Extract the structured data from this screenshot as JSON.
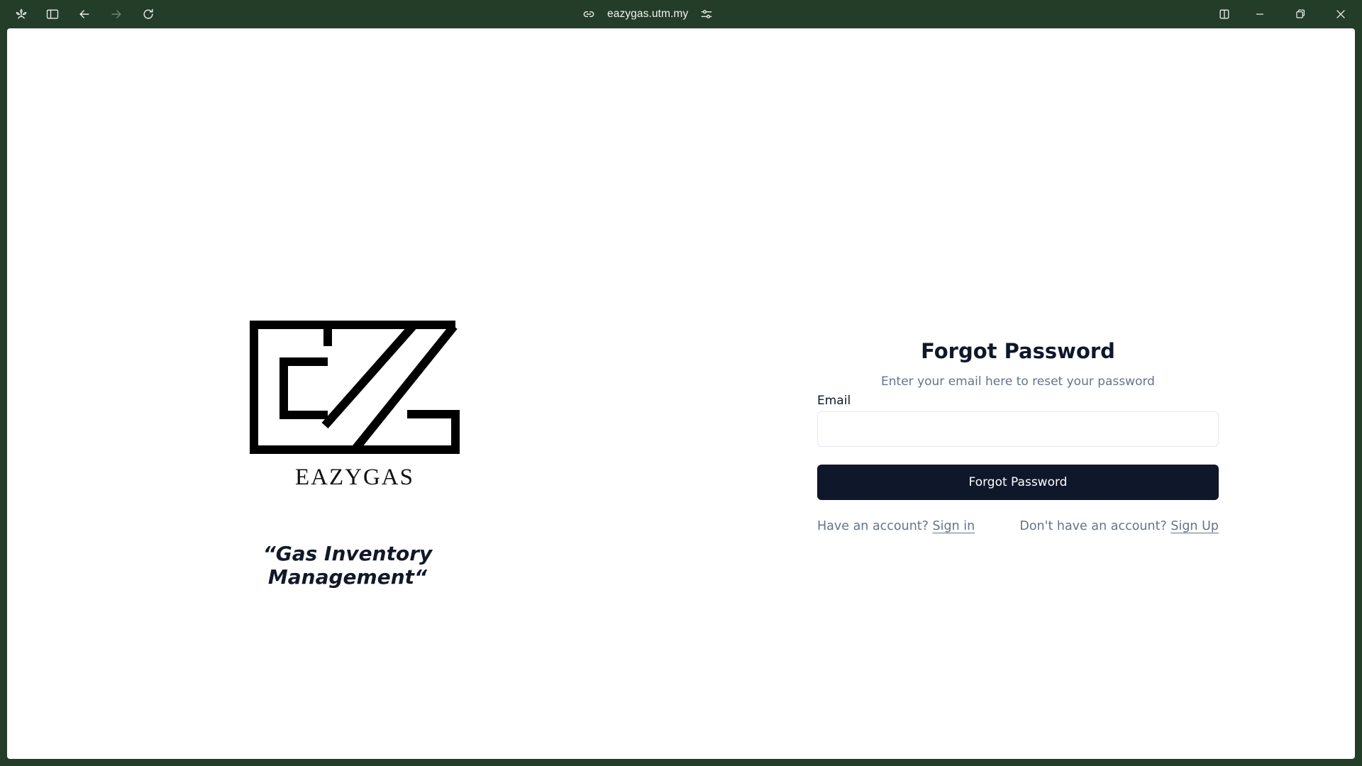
{
  "browser": {
    "url": "eazygas.utm.my",
    "icons": {
      "app": "flower-icon",
      "sidebar": "sidebar-toggle-icon",
      "back": "arrow-left-icon",
      "forward": "arrow-right-icon",
      "reload": "reload-icon",
      "link": "link-icon",
      "site_settings": "sliders-icon",
      "split": "split-view-icon",
      "minimize": "minimize-icon",
      "restore": "restore-icon",
      "close": "close-icon"
    },
    "colors": {
      "chrome": "#233d28"
    }
  },
  "brand": {
    "logo_text": "EAZYGAS",
    "tagline": "“Gas Inventory Management“"
  },
  "form": {
    "title": "Forgot Password",
    "subtitle": "Enter your email here to reset your password",
    "email_label": "Email",
    "email_value": "",
    "email_placeholder": "",
    "submit_label": "Forgot Password",
    "have_account_text": "Have an account?",
    "sign_in_label": "Sign in",
    "no_account_text": "Don't have an account?",
    "sign_up_label": "Sign Up"
  },
  "colors": {
    "primary_button": "#0f172a",
    "muted_text": "#64748b",
    "heading_text": "#0f172a"
  }
}
